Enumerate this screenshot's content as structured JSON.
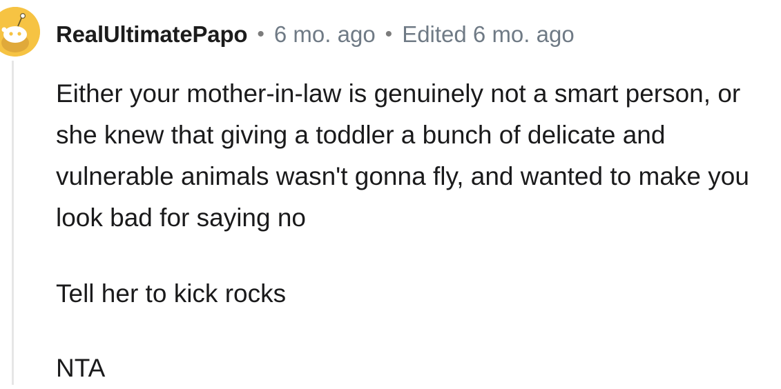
{
  "comment": {
    "author": "RealUltimatePapo",
    "separator": "•",
    "time_ago": "6 mo. ago",
    "edited": "Edited 6 mo. ago",
    "paragraphs": [
      "Either your mother-in-law is genuinely not a smart person, or she knew that giving a toddler a bunch of delicate and vulnerable animals wasn't gonna fly, and wanted to make you look bad for saying no",
      "Tell her to kick rocks",
      "NTA"
    ]
  },
  "colors": {
    "avatar_bg": "#f6c343",
    "username": "#1c1c1c",
    "meta_text": "#6f7a85",
    "body_text": "#1a1a1b",
    "thread_line": "#e6e6e6"
  },
  "icons": {
    "avatar": "snoo-avatar-icon"
  }
}
